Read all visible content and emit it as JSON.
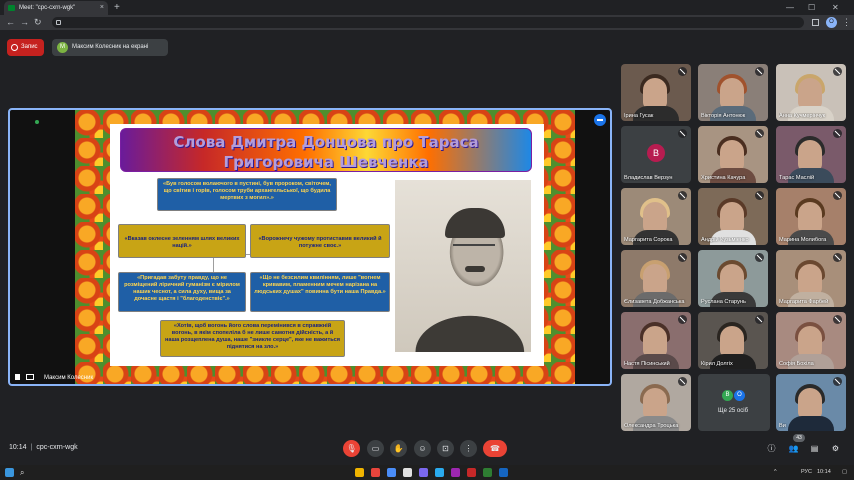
{
  "browser": {
    "tab_title": "Meet: \"cpc-cxrn-wgk\"",
    "tab_close": "×",
    "new_tab": "+",
    "back": "←",
    "forward": "→",
    "reload": "↻",
    "url": "",
    "profile_letter": "O",
    "menu": "⋮",
    "minimize": "—",
    "maximize": "☐",
    "close": "✕"
  },
  "meet": {
    "record_label": "Запис",
    "presenting_avatar": "M",
    "presenting_text": "Максим Колесник на екрані",
    "presenter_name": "Максим Колесник",
    "time": "10:14",
    "meeting_code": "cpc-cxrn-wgk",
    "participants_badge": "43"
  },
  "slide": {
    "title": "Слова Дмитра Донцова про Тараса Григоровича Шевченка",
    "quotes": [
      "«Був голосом волаючого в пустині, був пророком, світочем, що світив і горів, голосом труби архангельської, що будила мертвих з могил».»",
      "«Вказав оклеєне зеленням шлях великих націй.»",
      "«Ворожнечу чужому протиставив великий й потужне своє.»",
      "«Пригадав забуту правду, що не розміщений ліричний гуманізм є мірилом нашик чеснот, а сила духу, вища за дочасне щастя і \"благоденствіє\".»",
      "«Що не безсилим квилінням, лише \"вогнем кривавим, пламенним мечем нарізана на людських душах\" повинна бути наша Правда.»",
      "«Хотів, щоб вогонь його слова перемінився в справжній вогонь, в якім спопеліла б не лише самотня дійсність, а й наша розщеплена душа, наше \"зникле серце\", яке не важиться піднятися на зло.»"
    ]
  },
  "participants": [
    {
      "name": "Ірина Гусак",
      "bg": "#6b5a4e",
      "hair": "#3b2a20",
      "body": "#2c2c2c"
    },
    {
      "name": "Вікторія Антонюк",
      "bg": "#8a7f78",
      "hair": "#a0522d",
      "body": "#5a6b7a"
    },
    {
      "name": "Анна Кучмерінчук",
      "bg": "#c9c1b8",
      "hair": "#c9a66b",
      "body": "#d8d2c8"
    },
    {
      "name": "Владислав Верзун",
      "letter": "В",
      "letter_bg": "#b71c50"
    },
    {
      "name": "Христина Качура",
      "bg": "#a89482",
      "hair": "#4a2e20",
      "body": "#6d4c41"
    },
    {
      "name": "Тарас Маслій",
      "bg": "#7a5a6a",
      "hair": "#2b2b2b",
      "body": "#3b4b5b"
    },
    {
      "name": "Маргарита Сорока",
      "bg": "#9c8a78",
      "hair": "#e0c08a",
      "body": "#333"
    },
    {
      "name": "Андрій Кузьміенко",
      "bg": "#7d6a58",
      "hair": "#5a3a28",
      "body": "#e0e0e0"
    },
    {
      "name": "Марина Молибога",
      "bg": "#a6806a",
      "hair": "#5a3a20",
      "body": "#4a4a4a"
    },
    {
      "name": "Єлизавета Добжанська",
      "bg": "#8e7a6a",
      "hair": "#c8a070",
      "body": "#6b6b6b"
    },
    {
      "name": "Руслана Старунь",
      "bg": "#8d9a9a",
      "hair": "#6b4a30",
      "body": "#3a3a3a"
    },
    {
      "name": "Маргарита Фарбей",
      "bg": "#a88f7a",
      "hair": "#6a4830",
      "body": "#c0b0a0"
    },
    {
      "name": "Настя Пісинський",
      "bg": "#8a6e6e",
      "hair": "#4a3028",
      "body": "#5a4a4a"
    },
    {
      "name": "Кірил Долгіх",
      "bg": "#5a5550",
      "hair": "#2a2520",
      "body": "#1f1f1f"
    },
    {
      "name": "Софія Бохіла",
      "bg": "#a88a80",
      "hair": "#7a5040",
      "body": "#b0a098"
    },
    {
      "name": "Олександра Троцька",
      "bg": "#b0a8a0",
      "hair": "#8a6a50",
      "body": "#8a8a8a"
    },
    {
      "name": "Ви",
      "bg": "#6a8aa8",
      "hair": "#2a2a2a",
      "body": "#1e2a3a"
    }
  ],
  "more": {
    "text": "Ще 25 осіб",
    "avatars": [
      {
        "letter": "В",
        "color": "#34a853"
      },
      {
        "letter": "О",
        "color": "#1a73e8"
      }
    ]
  },
  "taskbar": {
    "search_icon": "⌕",
    "lang": "РУС",
    "clock": "10:14",
    "start_icon": "windows-logo"
  }
}
